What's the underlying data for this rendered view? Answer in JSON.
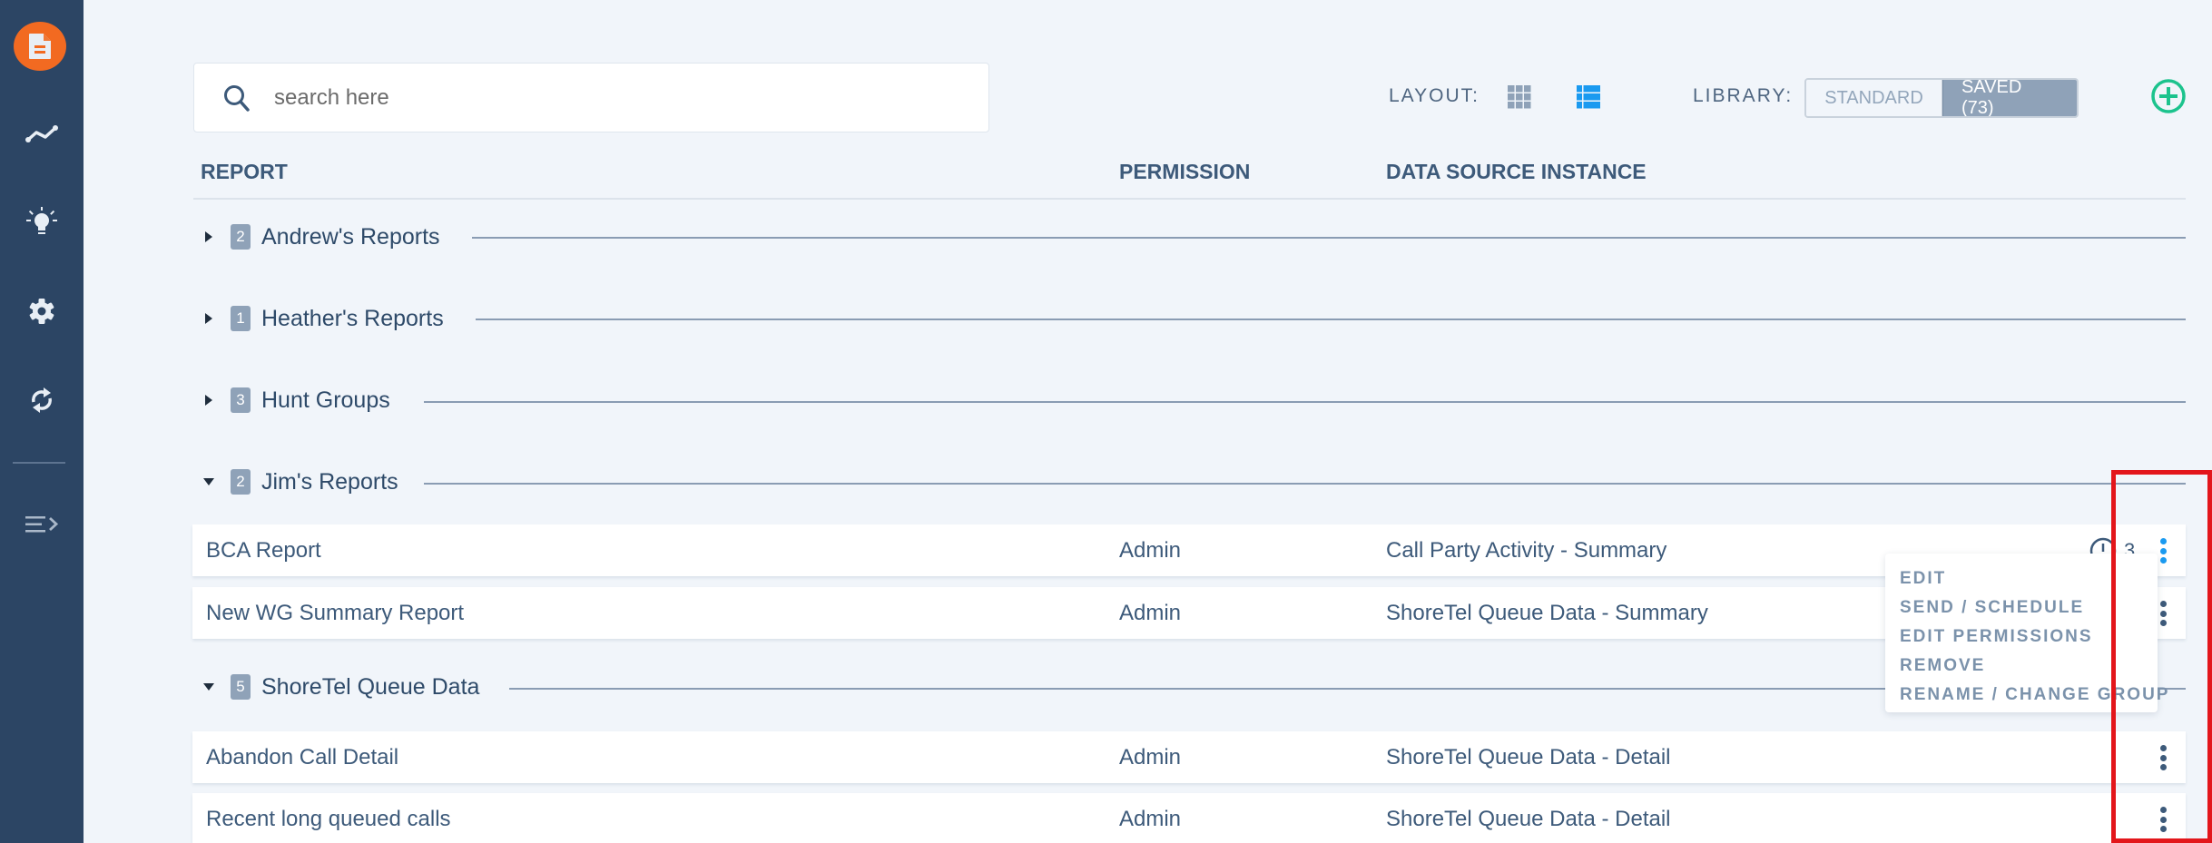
{
  "sidebar": {
    "items": [
      {
        "name": "reports",
        "icon": "document-icon",
        "active": true
      },
      {
        "name": "analytics",
        "icon": "trend-line-icon"
      },
      {
        "name": "insights",
        "icon": "lightbulb-icon"
      },
      {
        "name": "settings",
        "icon": "gear-icon"
      },
      {
        "name": "sync",
        "icon": "refresh-icon"
      }
    ],
    "collapse_icon": "expand-menu-icon"
  },
  "search": {
    "placeholder": "search here",
    "value": ""
  },
  "toolbar": {
    "layout_label": "LAYOUT:",
    "layout_options": [
      "grid",
      "list"
    ],
    "layout_selected": "list",
    "library_label": "LIBRARY:",
    "library_standard": "STANDARD",
    "library_saved": "SAVED (73)",
    "library_selected": "saved",
    "add_icon": "plus-circle-icon"
  },
  "columns": {
    "report": "REPORT",
    "permission": "PERMISSION",
    "data_source": "DATA SOURCE INSTANCE"
  },
  "groups": [
    {
      "name": "Andrew's Reports",
      "count": "2",
      "expanded": false
    },
    {
      "name": "Heather's Reports",
      "count": "1",
      "expanded": false
    },
    {
      "name": "Hunt Groups",
      "count": "3",
      "expanded": false
    },
    {
      "name": "Jim's Reports",
      "count": "2",
      "expanded": true,
      "rows": [
        {
          "report": "BCA Report",
          "permission": "Admin",
          "data_source": "Call Party Activity - Summary",
          "schedule_count": "3",
          "menu_open": true
        },
        {
          "report": "New WG Summary Report",
          "permission": "Admin",
          "data_source": "ShoreTel Queue Data - Summary"
        }
      ]
    },
    {
      "name": "ShoreTel Queue Data",
      "count": "5",
      "expanded": true,
      "rows": [
        {
          "report": "Abandon Call Detail",
          "permission": "Admin",
          "data_source": "ShoreTel Queue Data - Detail"
        },
        {
          "report": "Recent long queued calls",
          "permission": "Admin",
          "data_source": "ShoreTel Queue Data - Detail"
        }
      ]
    }
  ],
  "context_menu": {
    "items": [
      "EDIT",
      "SEND / SCHEDULE",
      "EDIT PERMISSIONS",
      "REMOVE",
      "RENAME / CHANGE GROUP"
    ]
  },
  "colors": {
    "sidebar": "#2c4564",
    "accent_orange": "#f26a21",
    "accent_blue": "#1a9af0",
    "accent_green": "#1cc38d",
    "annotation_red": "#e3161b"
  }
}
